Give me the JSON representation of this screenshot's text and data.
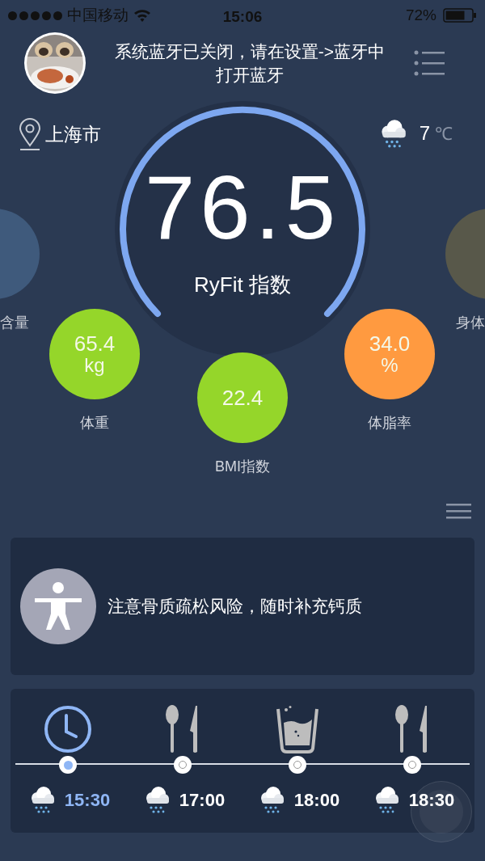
{
  "status_bar": {
    "carrier": "中国移动",
    "time": "15:06",
    "battery": "72%"
  },
  "header": {
    "message": "系统蓝牙已关闭，请在设置->蓝牙中打开蓝牙"
  },
  "location": {
    "city": "上海市"
  },
  "weather": {
    "temperature": "7",
    "unit": "℃"
  },
  "score": {
    "value": "76.5",
    "label": "RyFit 指数"
  },
  "side_metrics": [
    {
      "label": "含量",
      "color": "#3f5a7c"
    },
    {
      "label": "身体",
      "color": "#58584a"
    }
  ],
  "metrics": [
    {
      "value": "65.4",
      "unit": "kg",
      "label": "体重",
      "color": "#95d62a"
    },
    {
      "value": "22.4",
      "label": "BMI指数",
      "color": "#95d62a"
    },
    {
      "value": "34.0",
      "unit": "%",
      "label": "体脂率",
      "color": "#ff9a40"
    }
  ],
  "tip": {
    "text": "注意骨质疏松风险，随时补充钙质"
  },
  "schedule": [
    {
      "kind": "clock",
      "time": "15:30",
      "selected": true
    },
    {
      "kind": "meal",
      "time": "17:00",
      "selected": false
    },
    {
      "kind": "drink",
      "time": "18:00",
      "selected": false
    },
    {
      "kind": "meal",
      "time": "18:30",
      "selected": false
    }
  ]
}
